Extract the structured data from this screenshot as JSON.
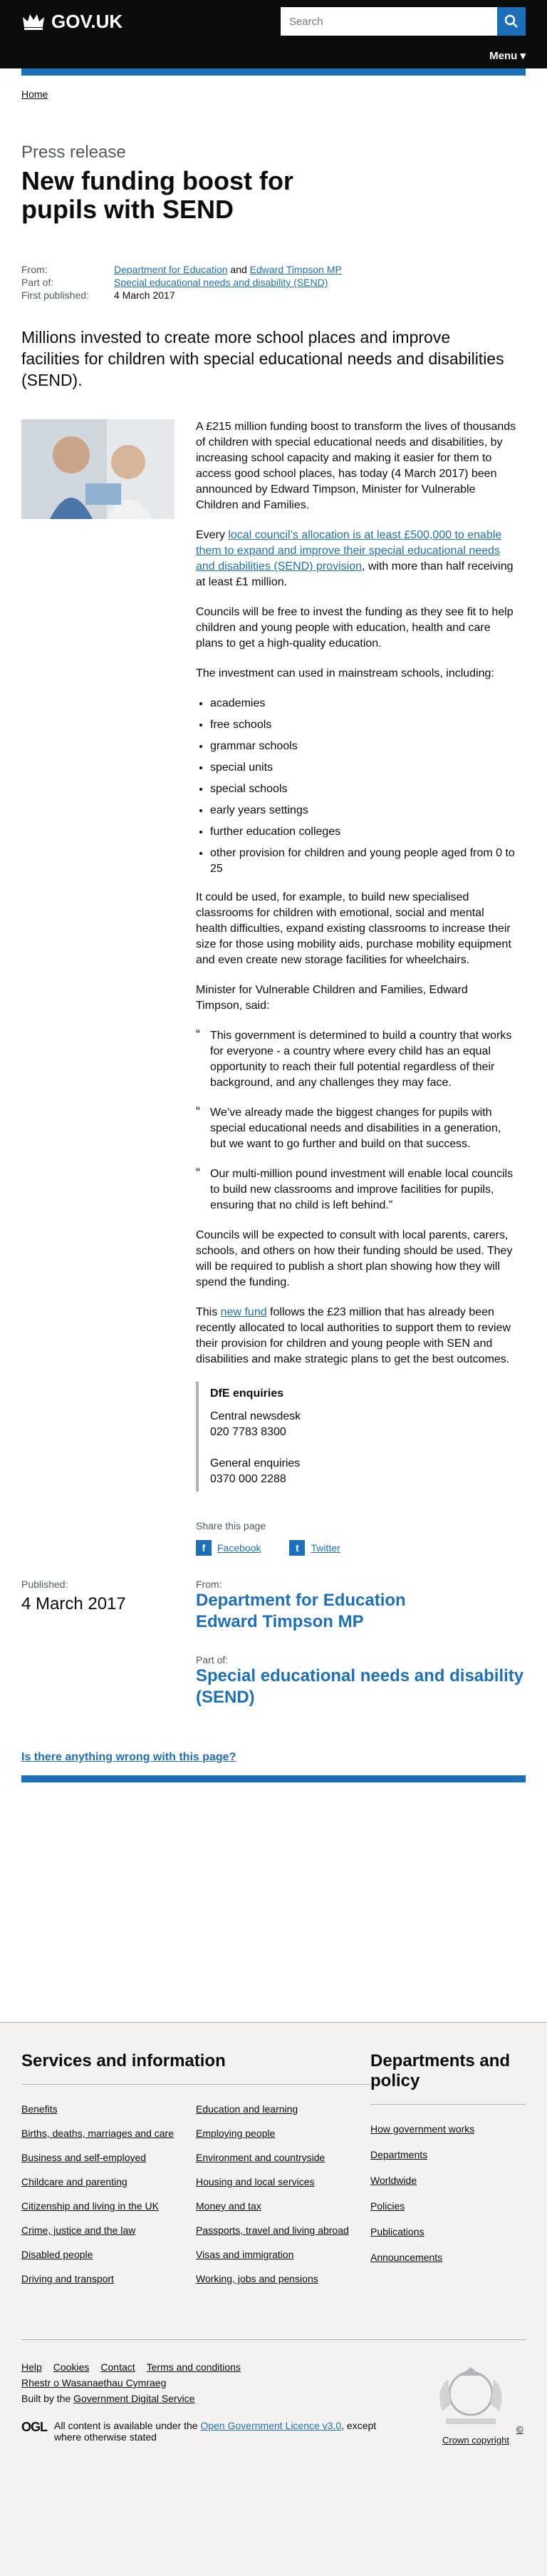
{
  "header": {
    "logo_text": "GOV.UK",
    "search_placeholder": "Search",
    "menu_label": "Menu"
  },
  "breadcrumb": [
    "Home"
  ],
  "page": {
    "kicker": "Press release",
    "title": "New funding boost for pupils with SEND"
  },
  "meta": {
    "from_label": "From:",
    "from_org1": "Department for Education",
    "from_and": "and",
    "from_org2": "Edward Timpson MP",
    "partof_label": "Part of:",
    "partof": "Special educational needs and disability (SEND)",
    "published_label": "First published:",
    "published": "4 March 2017"
  },
  "summary": "Millions invested to create more school places and improve facilities for children with special educational needs and disabilities (SEND).",
  "body": {
    "p1": "A £215 million funding boost to transform the lives of thousands of children with special educational needs and disabilities, by increasing school capacity and making it easier for them to access good school places, has today (4 March 2017) been announced by Edward Timpson, Minister for Vulnerable Children and Families.",
    "p2_pre": "Every ",
    "p2_link": "local council’s allocation is at least £500,000 to enable them to expand and improve their special educational needs and disabilities (SEND) provision",
    "p2_post": ", with more than half receiving at least £1 million.",
    "p3": "Councils will be free to invest the funding as they see fit to help children and young people with education, health and care plans to get a high-quality education.",
    "p4": "The investment can used in mainstream schools, including:",
    "list": [
      "academies",
      "free schools",
      "grammar schools",
      "special units",
      "special schools",
      "early years settings",
      "further education colleges",
      "other provision for children and young people aged from 0 to 25"
    ],
    "p5": "It could be used, for example, to build new specialised classrooms for children with emotional, social and mental health difficulties, expand existing classrooms to increase their size for those using mobility aids, purchase mobility equipment and even create new storage facilities for wheelchairs.",
    "p6": "Minister for Vulnerable Children and Families, Edward Timpson, said:",
    "quotes": [
      "This government is determined to build a country that works for everyone - a country where every child has an equal opportunity to reach their full potential regardless of their background, and any challenges they may face.",
      "We’ve already made the biggest changes for pupils with special educational needs and disabilities in a generation, but we want to go further and build on that success.",
      "Our multi-million pound investment will enable local councils to build new classrooms and improve facilities for pupils, ensuring that no child is left behind.”"
    ],
    "p7": "Councils will be expected to consult with local parents, carers, schools, and others on how their funding should be used. They will be required to publish a short plan showing how they will spend the funding.",
    "p8_pre": "This ",
    "p8_link": "new fund",
    "p8_post": " follows the £23 million that has already been recently allocated to local authorities to support them to review their provision for children and young people with SEN and disabilities and make strategic plans to get the best outcomes."
  },
  "contact": {
    "title": "DfE enquiries",
    "newsdesk_label": "Central newsdesk",
    "newsdesk_phone": "020 7783 8300",
    "general_label": "General enquiries",
    "general_phone": "0370 000 2288"
  },
  "share": {
    "title": "Share this page",
    "facebook": "Facebook",
    "twitter": "Twitter"
  },
  "footer_meta": {
    "published_label": "Published:",
    "published_date": "4 March 2017",
    "from_label": "From:",
    "org1": "Department for Education",
    "org2": "Edward Timpson MP",
    "partof_label": "Part of:",
    "partof": "Special educational needs and disability (SEND)"
  },
  "feedback": {
    "link": "Is there anything wrong with this page?"
  },
  "footer": {
    "services_title": "Services and information",
    "services": [
      "Benefits",
      "Education and learning",
      "Births, deaths, marriages and care",
      "Employing people",
      "Business and self-employed",
      "Environment and countryside",
      "Childcare and parenting",
      "Housing and local services",
      "Citizenship and living in the UK",
      "Money and tax",
      "Crime, justice and the law",
      "Passports, travel and living abroad",
      "Disabled people",
      "Visas and immigration",
      "Driving and transport",
      "Working, jobs and pensions"
    ],
    "departments_title": "Departments and policy",
    "departments": [
      "How government works",
      "Departments",
      "Worldwide",
      "Policies",
      "Publications",
      "Announcements"
    ],
    "bottom_links": [
      "Help",
      "Cookies",
      "Contact",
      "Terms and conditions",
      "Rhestr o Wasanaethau Cymraeg"
    ],
    "built_by_pre": "Built by the ",
    "built_by_link": "Government Digital Service",
    "ogl_logo": "OGL",
    "licence_pre": "All content is available under the ",
    "licence_link": "Open Government Licence v3.0",
    "licence_post": ", except where otherwise stated",
    "copyright": "© Crown copyright"
  }
}
